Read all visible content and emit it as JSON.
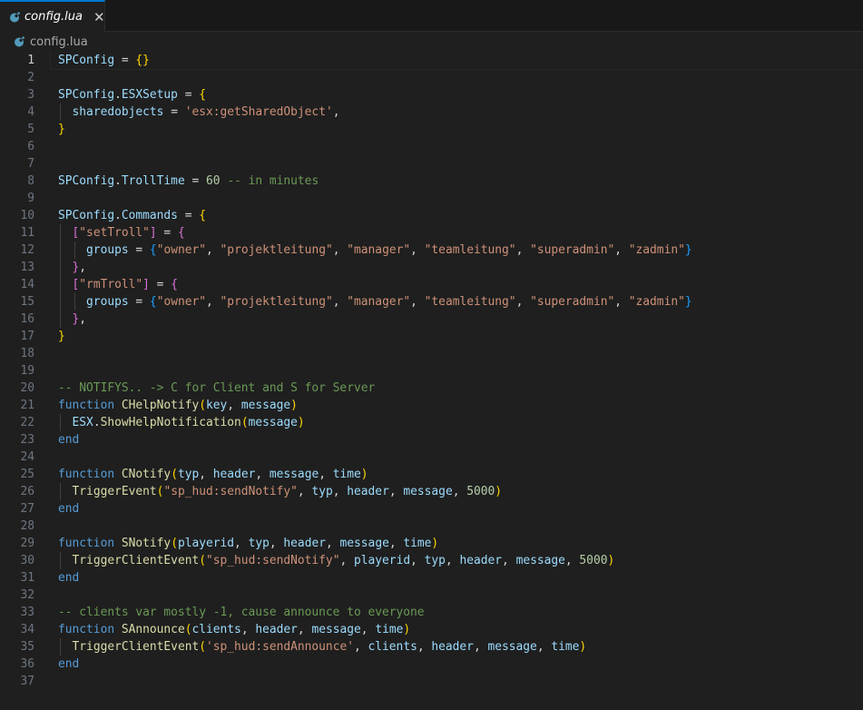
{
  "tab": {
    "label": "config.lua",
    "close_glyph": "✕",
    "icon": "lua-file-icon"
  },
  "breadcrumb": {
    "label": "config.lua",
    "icon": "lua-file-icon"
  },
  "colors": {
    "accent": "#0078d4",
    "lua_icon": "#519aba",
    "keyword": "#569cd6",
    "function": "#dcdcaa",
    "variable": "#9cdcfe",
    "string": "#ce9178",
    "number": "#b5cea8",
    "comment": "#6a9955",
    "bracket1": "#ffd700",
    "bracket2": "#da70d6",
    "bracket3": "#179fff"
  },
  "editor": {
    "current_line": 1,
    "lines": [
      [
        [
          "var",
          "SPConfig"
        ],
        [
          "op",
          " = "
        ],
        [
          "p1",
          "{}"
        ]
      ],
      [],
      [
        [
          "var",
          "SPConfig"
        ],
        [
          "op",
          "."
        ],
        [
          "var",
          "ESXSetup"
        ],
        [
          "op",
          " = "
        ],
        [
          "p1",
          "{"
        ]
      ],
      [
        [
          "op",
          "  "
        ],
        [
          "var",
          "sharedobjects"
        ],
        [
          "op",
          " = "
        ],
        [
          "str",
          "'esx:getSharedObject'"
        ],
        [
          "op",
          ","
        ]
      ],
      [
        [
          "p1",
          "}"
        ]
      ],
      [],
      [],
      [
        [
          "var",
          "SPConfig"
        ],
        [
          "op",
          "."
        ],
        [
          "var",
          "TrollTime"
        ],
        [
          "op",
          " = "
        ],
        [
          "num",
          "60"
        ],
        [
          "op",
          " "
        ],
        [
          "cmt",
          "-- in minutes"
        ]
      ],
      [],
      [
        [
          "var",
          "SPConfig"
        ],
        [
          "op",
          "."
        ],
        [
          "var",
          "Commands"
        ],
        [
          "op",
          " = "
        ],
        [
          "p1",
          "{"
        ]
      ],
      [
        [
          "op",
          "  "
        ],
        [
          "p2",
          "["
        ],
        [
          "str",
          "\"setTroll\""
        ],
        [
          "p2",
          "]"
        ],
        [
          "op",
          " = "
        ],
        [
          "p2",
          "{"
        ]
      ],
      [
        [
          "op",
          "    "
        ],
        [
          "var",
          "groups"
        ],
        [
          "op",
          " = "
        ],
        [
          "p3",
          "{"
        ],
        [
          "str",
          "\"owner\""
        ],
        [
          "op",
          ", "
        ],
        [
          "str",
          "\"projektleitung\""
        ],
        [
          "op",
          ", "
        ],
        [
          "str",
          "\"manager\""
        ],
        [
          "op",
          ", "
        ],
        [
          "str",
          "\"teamleitung\""
        ],
        [
          "op",
          ", "
        ],
        [
          "str",
          "\"superadmin\""
        ],
        [
          "op",
          ", "
        ],
        [
          "str",
          "\"zadmin\""
        ],
        [
          "p3",
          "}"
        ]
      ],
      [
        [
          "op",
          "  "
        ],
        [
          "p2",
          "}"
        ],
        [
          "op",
          ","
        ]
      ],
      [
        [
          "op",
          "  "
        ],
        [
          "p2",
          "["
        ],
        [
          "str",
          "\"rmTroll\""
        ],
        [
          "p2",
          "]"
        ],
        [
          "op",
          " = "
        ],
        [
          "p2",
          "{"
        ]
      ],
      [
        [
          "op",
          "    "
        ],
        [
          "var",
          "groups"
        ],
        [
          "op",
          " = "
        ],
        [
          "p3",
          "{"
        ],
        [
          "str",
          "\"owner\""
        ],
        [
          "op",
          ", "
        ],
        [
          "str",
          "\"projektleitung\""
        ],
        [
          "op",
          ", "
        ],
        [
          "str",
          "\"manager\""
        ],
        [
          "op",
          ", "
        ],
        [
          "str",
          "\"teamleitung\""
        ],
        [
          "op",
          ", "
        ],
        [
          "str",
          "\"superadmin\""
        ],
        [
          "op",
          ", "
        ],
        [
          "str",
          "\"zadmin\""
        ],
        [
          "p3",
          "}"
        ]
      ],
      [
        [
          "op",
          "  "
        ],
        [
          "p2",
          "}"
        ],
        [
          "op",
          ","
        ]
      ],
      [
        [
          "p1",
          "}"
        ]
      ],
      [],
      [],
      [
        [
          "cmt",
          "-- NOTIFYS.. -> C for Client and S for Server"
        ]
      ],
      [
        [
          "kw",
          "function"
        ],
        [
          "op",
          " "
        ],
        [
          "fn",
          "CHelpNotify"
        ],
        [
          "p1",
          "("
        ],
        [
          "var",
          "key"
        ],
        [
          "op",
          ", "
        ],
        [
          "var",
          "message"
        ],
        [
          "p1",
          ")"
        ]
      ],
      [
        [
          "op",
          "  "
        ],
        [
          "var",
          "ESX"
        ],
        [
          "op",
          "."
        ],
        [
          "fn",
          "ShowHelpNotification"
        ],
        [
          "p1",
          "("
        ],
        [
          "var",
          "message"
        ],
        [
          "p1",
          ")"
        ]
      ],
      [
        [
          "kw",
          "end"
        ]
      ],
      [],
      [
        [
          "kw",
          "function"
        ],
        [
          "op",
          " "
        ],
        [
          "fn",
          "CNotify"
        ],
        [
          "p1",
          "("
        ],
        [
          "var",
          "typ"
        ],
        [
          "op",
          ", "
        ],
        [
          "var",
          "header"
        ],
        [
          "op",
          ", "
        ],
        [
          "var",
          "message"
        ],
        [
          "op",
          ", "
        ],
        [
          "var",
          "time"
        ],
        [
          "p1",
          ")"
        ]
      ],
      [
        [
          "op",
          "  "
        ],
        [
          "fn",
          "TriggerEvent"
        ],
        [
          "p1",
          "("
        ],
        [
          "str",
          "\"sp_hud:sendNotify\""
        ],
        [
          "op",
          ", "
        ],
        [
          "var",
          "typ"
        ],
        [
          "op",
          ", "
        ],
        [
          "var",
          "header"
        ],
        [
          "op",
          ", "
        ],
        [
          "var",
          "message"
        ],
        [
          "op",
          ", "
        ],
        [
          "num",
          "5000"
        ],
        [
          "p1",
          ")"
        ]
      ],
      [
        [
          "kw",
          "end"
        ]
      ],
      [],
      [
        [
          "kw",
          "function"
        ],
        [
          "op",
          " "
        ],
        [
          "fn",
          "SNotify"
        ],
        [
          "p1",
          "("
        ],
        [
          "var",
          "playerid"
        ],
        [
          "op",
          ", "
        ],
        [
          "var",
          "typ"
        ],
        [
          "op",
          ", "
        ],
        [
          "var",
          "header"
        ],
        [
          "op",
          ", "
        ],
        [
          "var",
          "message"
        ],
        [
          "op",
          ", "
        ],
        [
          "var",
          "time"
        ],
        [
          "p1",
          ")"
        ]
      ],
      [
        [
          "op",
          "  "
        ],
        [
          "fn",
          "TriggerClientEvent"
        ],
        [
          "p1",
          "("
        ],
        [
          "str",
          "\"sp_hud:sendNotify\""
        ],
        [
          "op",
          ", "
        ],
        [
          "var",
          "playerid"
        ],
        [
          "op",
          ", "
        ],
        [
          "var",
          "typ"
        ],
        [
          "op",
          ", "
        ],
        [
          "var",
          "header"
        ],
        [
          "op",
          ", "
        ],
        [
          "var",
          "message"
        ],
        [
          "op",
          ", "
        ],
        [
          "num",
          "5000"
        ],
        [
          "p1",
          ")"
        ]
      ],
      [
        [
          "kw",
          "end"
        ]
      ],
      [],
      [
        [
          "cmt",
          "-- clients var mostly -1, cause announce to everyone"
        ]
      ],
      [
        [
          "kw",
          "function"
        ],
        [
          "op",
          " "
        ],
        [
          "fn",
          "SAnnounce"
        ],
        [
          "p1",
          "("
        ],
        [
          "var",
          "clients"
        ],
        [
          "op",
          ", "
        ],
        [
          "var",
          "header"
        ],
        [
          "op",
          ", "
        ],
        [
          "var",
          "message"
        ],
        [
          "op",
          ", "
        ],
        [
          "var",
          "time"
        ],
        [
          "p1",
          ")"
        ]
      ],
      [
        [
          "op",
          "  "
        ],
        [
          "fn",
          "TriggerClientEvent"
        ],
        [
          "p1",
          "("
        ],
        [
          "str",
          "'sp_hud:sendAnnounce'"
        ],
        [
          "op",
          ", "
        ],
        [
          "var",
          "clients"
        ],
        [
          "op",
          ", "
        ],
        [
          "var",
          "header"
        ],
        [
          "op",
          ", "
        ],
        [
          "var",
          "message"
        ],
        [
          "op",
          ", "
        ],
        [
          "var",
          "time"
        ],
        [
          "p1",
          ")"
        ]
      ],
      [
        [
          "kw",
          "end"
        ]
      ],
      []
    ]
  }
}
